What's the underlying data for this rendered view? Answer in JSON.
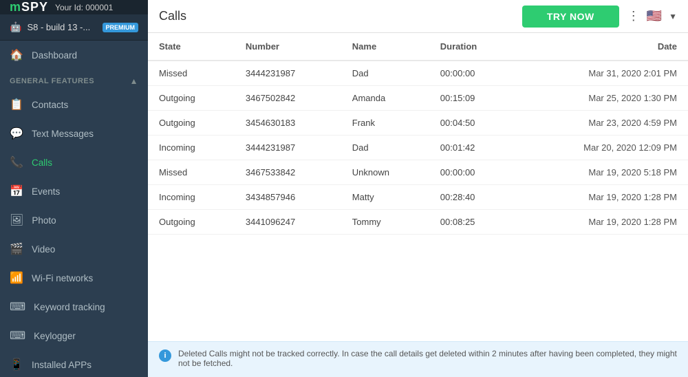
{
  "header": {
    "logo": "mSPY",
    "user_id_label": "Your Id: 000001",
    "try_now_label": "TRY NOW",
    "page_title": "Calls"
  },
  "device": {
    "name": "S8 - build 13 -...",
    "badge": "PREMIUM"
  },
  "sidebar": {
    "general_features_label": "GENERAL FEATURES",
    "items": [
      {
        "id": "dashboard",
        "label": "Dashboard",
        "icon": "🏠"
      },
      {
        "id": "contacts",
        "label": "Contacts",
        "icon": "📋"
      },
      {
        "id": "text-messages",
        "label": "Text Messages",
        "icon": "💬"
      },
      {
        "id": "calls",
        "label": "Calls",
        "icon": "📞",
        "active": true
      },
      {
        "id": "events",
        "label": "Events",
        "icon": "📅"
      },
      {
        "id": "photo",
        "label": "Photo",
        "icon": "🖼"
      },
      {
        "id": "video",
        "label": "Video",
        "icon": "🎬"
      },
      {
        "id": "wifi-networks",
        "label": "Wi-Fi networks",
        "icon": "📶"
      },
      {
        "id": "keyword-tracking",
        "label": "Keyword tracking",
        "icon": "⌨"
      },
      {
        "id": "keylogger",
        "label": "Keylogger",
        "icon": "⌨"
      },
      {
        "id": "installed-apps",
        "label": "Installed APPs",
        "icon": "📱"
      }
    ]
  },
  "table": {
    "columns": [
      "State",
      "Number",
      "Name",
      "Duration",
      "Date"
    ],
    "rows": [
      {
        "state": "Missed",
        "number": "3444231987",
        "name": "Dad",
        "duration": "00:00:00",
        "date": "Mar 31, 2020 2:01 PM"
      },
      {
        "state": "Outgoing",
        "number": "3467502842",
        "name": "Amanda",
        "duration": "00:15:09",
        "date": "Mar 25, 2020 1:30 PM"
      },
      {
        "state": "Outgoing",
        "number": "3454630183",
        "name": "Frank",
        "duration": "00:04:50",
        "date": "Mar 23, 2020 4:59 PM"
      },
      {
        "state": "Incoming",
        "number": "3444231987",
        "name": "Dad",
        "duration": "00:01:42",
        "date": "Mar 20, 2020 12:09 PM"
      },
      {
        "state": "Missed",
        "number": "3467533842",
        "name": "Unknown",
        "duration": "00:00:00",
        "date": "Mar 19, 2020 5:18 PM"
      },
      {
        "state": "Incoming",
        "number": "3434857946",
        "name": "Matty",
        "duration": "00:28:40",
        "date": "Mar 19, 2020 1:28 PM"
      },
      {
        "state": "Outgoing",
        "number": "3441096247",
        "name": "Tommy",
        "duration": "00:08:25",
        "date": "Mar 19, 2020 1:28 PM"
      }
    ]
  },
  "info_bar": {
    "text": "Deleted Calls might not be tracked correctly. In case the call details get deleted within 2 minutes after having been completed, they might not be fetched."
  },
  "colors": {
    "active_green": "#2ecc71",
    "sidebar_bg": "#2c3e50",
    "accent_blue": "#3498db"
  }
}
